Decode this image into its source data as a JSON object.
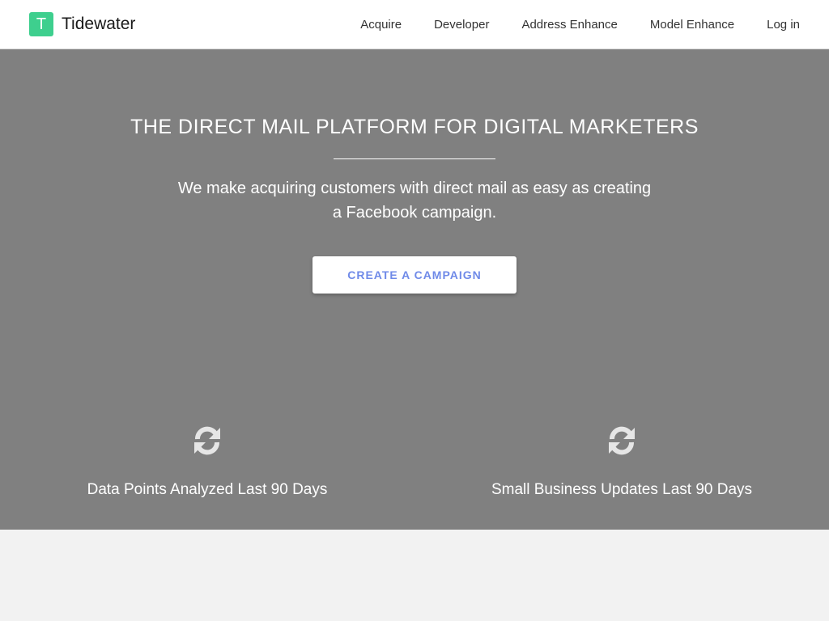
{
  "header": {
    "brand_initial": "T",
    "brand_name": "Tidewater",
    "nav": [
      "Acquire",
      "Developer",
      "Address Enhance",
      "Model Enhance",
      "Log in"
    ]
  },
  "hero": {
    "title": "THE DIRECT MAIL PLATFORM FOR DIGITAL MARKETERS",
    "subtitle": "We make acquiring customers with direct mail as easy as creating a Facebook campaign.",
    "cta_label": "CREATE A CAMPAIGN"
  },
  "stats": [
    {
      "icon": "refresh-icon",
      "label": "Data Points Analyzed Last 90 Days"
    },
    {
      "icon": "refresh-icon",
      "label": "Small Business Updates Last 90 Days"
    }
  ],
  "colors": {
    "brand_green": "#3ecf8e",
    "hero_background": "#808080",
    "cta_text": "#6f8ae8",
    "page_background": "#f2f2f2"
  }
}
